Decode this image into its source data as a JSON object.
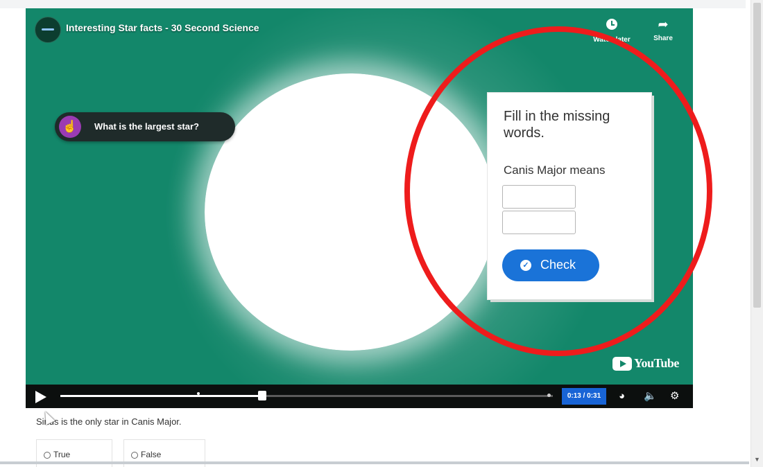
{
  "video": {
    "title": "Interesting Star facts - 30 Second Science",
    "watch_later_label": "Watch later",
    "share_label": "Share",
    "youtube_label": "YouTube",
    "time": "0:13 / 0:31",
    "progress_fraction": 0.41,
    "marker_fraction": 0.28
  },
  "hotspot": {
    "text": "What is the largest star?"
  },
  "fill_in_blanks": {
    "title": "Fill in the missing words.",
    "question": "Canis Major means",
    "blank_1_value": "",
    "blank_2_value": "",
    "check_label": "Check"
  },
  "true_false": {
    "statement": "Sirius is the only star in Canis Major.",
    "option_true": "True",
    "option_false": "False"
  },
  "colors": {
    "player_background": "#13876a",
    "check_button": "#1a73d8",
    "annotation": "#ee1c1c",
    "hotspot_icon": "#9b3bb3"
  },
  "icons": [
    "channel-avatar",
    "clock-icon",
    "share-icon",
    "pointer-hand-icon",
    "checkmark-icon",
    "youtube-logo",
    "play-icon",
    "speed-icon",
    "volume-icon",
    "settings-icon",
    "cursor-icon"
  ]
}
